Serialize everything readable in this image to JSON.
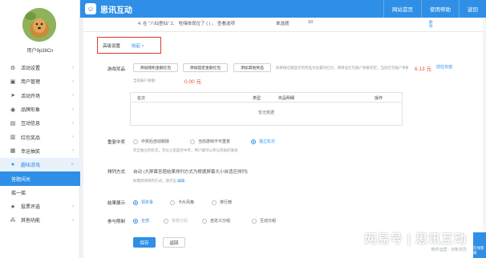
{
  "header": {
    "brand": "思讯互动",
    "links": [
      "网站首页",
      "使用帮助",
      "返回"
    ]
  },
  "sidebar": {
    "username": "用户9p38Cn",
    "items": [
      {
        "label": "活动设置",
        "icon": "gear-icon"
      },
      {
        "label": "用户管理",
        "icon": "user-icon"
      },
      {
        "label": "活动开场",
        "icon": "send-icon"
      },
      {
        "label": "品牌形象",
        "icon": "brand-icon"
      },
      {
        "label": "互动信息",
        "icon": "message-icon"
      },
      {
        "label": "红包奖品",
        "icon": "gift-icon"
      },
      {
        "label": "幸运抽奖",
        "icon": "lottery-icon"
      },
      {
        "label": "趣味游戏",
        "icon": "game-icon"
      },
      {
        "label": "答题闯关",
        "icon": ""
      },
      {
        "label": "摇一摇",
        "icon": ""
      },
      {
        "label": "投票评选",
        "icon": "star-icon"
      },
      {
        "label": "其他功能",
        "icon": "more-icon"
      }
    ]
  },
  "prev_row": {
    "question": "4. 在 \"八仙登仙\" 2、 吃嗨体现位了 ( ) 。 查看选项",
    "type": "单选题",
    "score": "10",
    "action": "删\n除"
  },
  "advanced": {
    "label": "高级设置",
    "toggle": "收起 ˄"
  },
  "game_prize": {
    "label": "游戏奖品",
    "buttons": [
      "添加随机金额红包",
      "添加固定金额红包",
      "添加其他奖品"
    ],
    "note_prefix": "如果微信端显示的奖品为设置的红包，请保证红包账户余额充足，当前红包账户余额：",
    "balance": "6.13 元",
    "recharge": "前往充值",
    "subnote_prefix": "当前账户余额：",
    "sub_balance": "0.00 元",
    "table": {
      "headers": [
        "名次",
        "类型",
        "奖品明细",
        "操作"
      ],
      "empty": "暂无数据"
    }
  },
  "rewind": {
    "label": "重复中奖",
    "options": [
      "中奖后自动剔除",
      "当前游戏不可重复",
      "独立轮次"
    ],
    "selected": 2,
    "hint": "完全独立的轮次，无论之前是否中奖，用户都可以参与奖励的发放"
  },
  "ranking": {
    "label": "排列方式",
    "value": "自动 (大屏幕答题结果排列方式为根据屏幕大小自适应排列)",
    "hint": "如需修改排列方式，请点击 ",
    "hint_link": "编辑"
  },
  "result_display": {
    "label": "结果展示",
    "options": [
      "领奖事",
      "卡片风格",
      "排行榜"
    ],
    "selected": 0
  },
  "participation": {
    "label": "参与限制",
    "options": [
      "全部",
      "答题分组",
      "自定义分组",
      "互动分组"
    ],
    "selected": 0
  },
  "actions": {
    "save": "保存",
    "back": "返回"
  },
  "watermark": {
    "text": "网易号 | 思讯互动",
    "sub": "软件运营 · 日新月异"
  },
  "float_button": "在线客服",
  "colors": {
    "primary": "#2f8fe6",
    "highlight": "#e03a2f",
    "price": "#e64b3c"
  }
}
